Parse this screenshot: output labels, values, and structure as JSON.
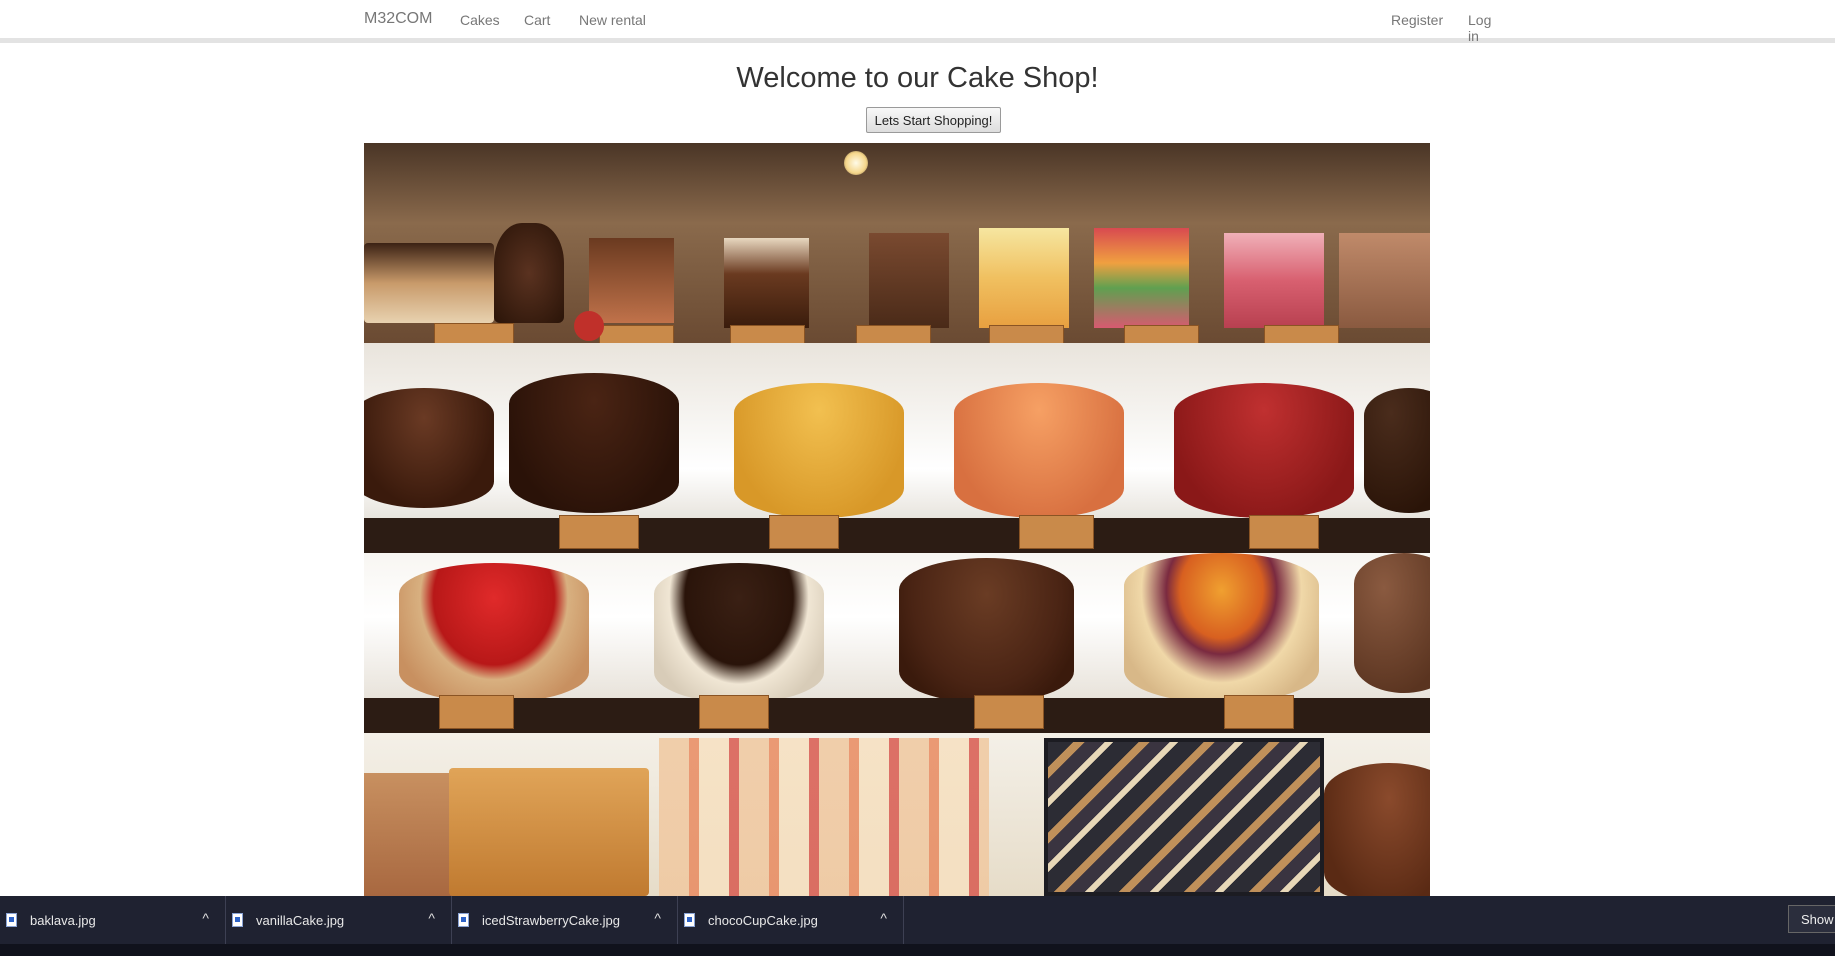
{
  "nav": {
    "brand": "M32COM",
    "links": [
      "Cakes",
      "Cart",
      "New rental"
    ],
    "right_links": [
      "Register",
      "Log in"
    ]
  },
  "main": {
    "title": "Welcome to our Cake Shop!",
    "button_label": "Lets Start Shopping!"
  },
  "downloads": {
    "items": [
      {
        "name": "baklava.jpg",
        "icon": "file-icon"
      },
      {
        "name": "vanillaCake.jpg",
        "icon": "file-icon"
      },
      {
        "name": "icedStrawberryCake.jpg",
        "icon": "file-icon"
      },
      {
        "name": "chocoCupCake.jpg",
        "icon": "file-icon"
      }
    ],
    "show_label": "Show",
    "chevron": "^"
  },
  "colors": {
    "nav_text": "#777777",
    "download_bar": "#1f2231"
  }
}
